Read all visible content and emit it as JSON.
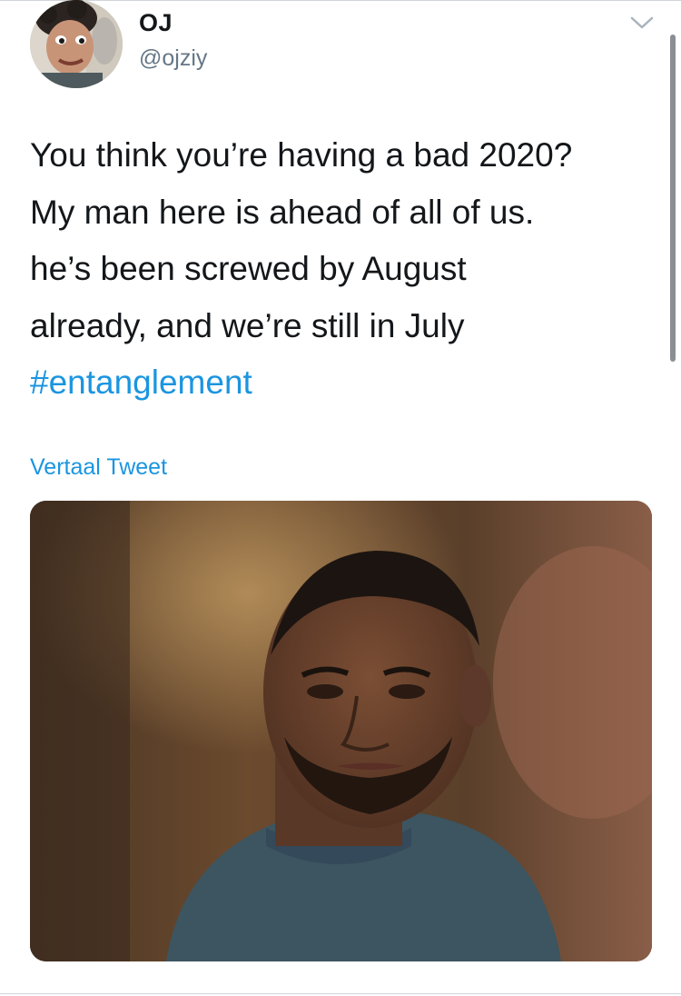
{
  "tweet": {
    "author": {
      "display_name": "OJ",
      "handle": "@ojziy",
      "avatar_icon": "profile-avatar"
    },
    "more_icon": "chevron-down-icon",
    "text_lines": [
      "You think you’re having a bad 2020?",
      "My man here is ahead of all of us.",
      "he’s been screwed by August",
      "already, and we’re still in July"
    ],
    "hashtag": "#entanglement",
    "translate_label": "Vertaal Tweet",
    "media": {
      "kind": "photo"
    }
  },
  "colors": {
    "text": "#14171a",
    "secondary": "#657786",
    "link": "#1b95e0",
    "border": "#d0d4d8"
  }
}
